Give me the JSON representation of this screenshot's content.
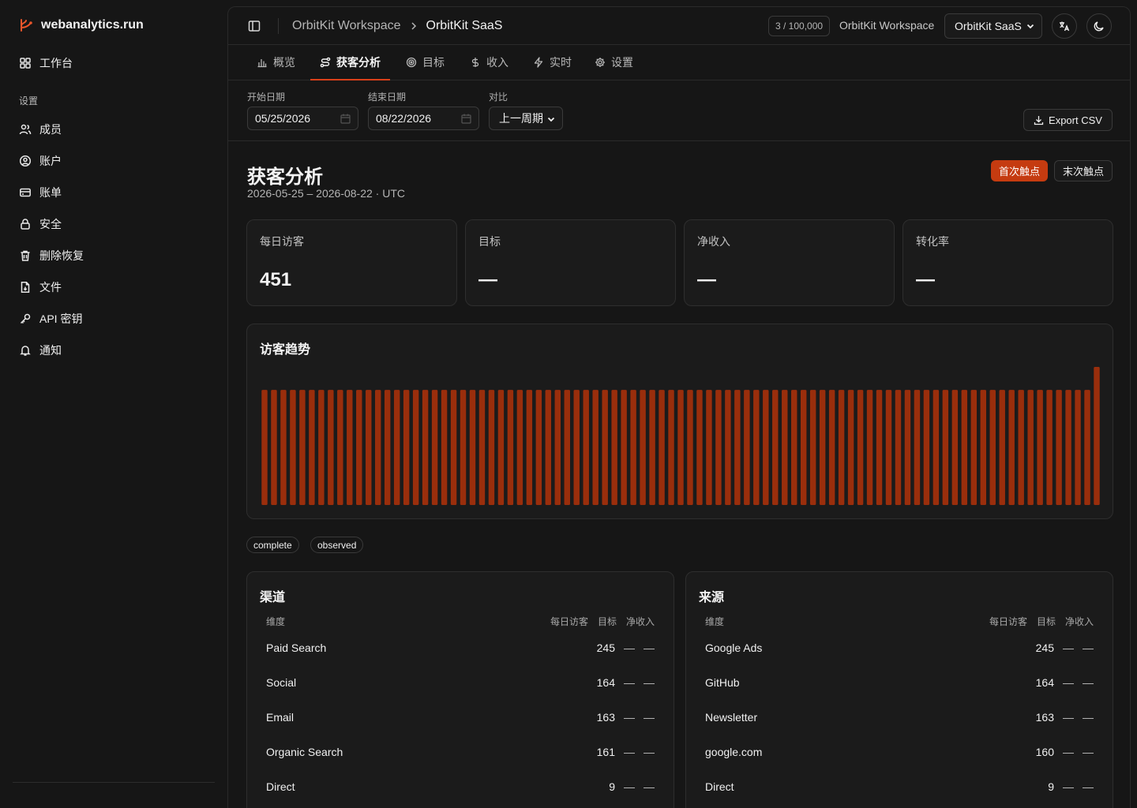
{
  "brand": {
    "name": "webanalytics.run"
  },
  "sidebar": {
    "workbench": "工作台",
    "section_label": "设置",
    "items": [
      {
        "label": "成员",
        "icon": "users-icon"
      },
      {
        "label": "账户",
        "icon": "user-circle-icon"
      },
      {
        "label": "账单",
        "icon": "credit-card-icon"
      },
      {
        "label": "安全",
        "icon": "lock-icon"
      },
      {
        "label": "删除恢复",
        "icon": "trash-icon"
      },
      {
        "label": "文件",
        "icon": "file-icon"
      },
      {
        "label": "API 密钥",
        "icon": "key-icon"
      },
      {
        "label": "通知",
        "icon": "bell-icon"
      }
    ]
  },
  "header": {
    "breadcrumb": [
      "OrbitKit Workspace",
      "OrbitKit SaaS"
    ],
    "usage": "3 / 100,000",
    "workspace": "OrbitKit Workspace",
    "project_select": "OrbitKit SaaS"
  },
  "tabs": [
    {
      "label": "概览",
      "icon": "bar-chart-icon",
      "active": false
    },
    {
      "label": "获客分析",
      "icon": "route-icon",
      "active": true
    },
    {
      "label": "目标",
      "icon": "target-icon",
      "active": false
    },
    {
      "label": "收入",
      "icon": "dollar-icon",
      "active": false
    },
    {
      "label": "实时",
      "icon": "bolt-icon",
      "active": false
    },
    {
      "label": "设置",
      "icon": "gear-icon",
      "active": false
    }
  ],
  "filters": {
    "start_label": "开始日期",
    "start_value": "05/25/2026",
    "end_label": "结束日期",
    "end_value": "08/22/2026",
    "compare_label": "对比",
    "compare_value": "上一周期",
    "export_label": "Export CSV"
  },
  "page": {
    "title": "获客分析",
    "subtitle": "2026-05-25 – 2026-08-22 · UTC",
    "first_touch": "首次触点",
    "last_touch": "末次触点"
  },
  "kpis": [
    {
      "label": "每日访客",
      "value": "451"
    },
    {
      "label": "目标",
      "value": "—"
    },
    {
      "label": "净收入",
      "value": "—"
    },
    {
      "label": "转化率",
      "value": "—"
    }
  ],
  "trend": {
    "title": "访客趋势"
  },
  "pills": [
    "complete",
    "observed"
  ],
  "channels": {
    "title": "渠道",
    "col_dim": "维度",
    "col_visitors": "每日访客",
    "col_goals": "目标",
    "col_revenue": "净收入",
    "rows": [
      {
        "name": "Paid Search",
        "visitors": "245",
        "goals": "—",
        "revenue": "—"
      },
      {
        "name": "Social",
        "visitors": "164",
        "goals": "—",
        "revenue": "—"
      },
      {
        "name": "Email",
        "visitors": "163",
        "goals": "—",
        "revenue": "—"
      },
      {
        "name": "Organic Search",
        "visitors": "161",
        "goals": "—",
        "revenue": "—"
      },
      {
        "name": "Direct",
        "visitors": "9",
        "goals": "—",
        "revenue": "—"
      }
    ]
  },
  "sources": {
    "title": "来源",
    "col_dim": "维度",
    "col_visitors": "每日访客",
    "col_goals": "目标",
    "col_revenue": "净收入",
    "rows": [
      {
        "name": "Google Ads",
        "visitors": "245",
        "goals": "—",
        "revenue": "—"
      },
      {
        "name": "GitHub",
        "visitors": "164",
        "goals": "—",
        "revenue": "—"
      },
      {
        "name": "Newsletter",
        "visitors": "163",
        "goals": "—",
        "revenue": "—"
      },
      {
        "name": "google.com",
        "visitors": "160",
        "goals": "—",
        "revenue": "—"
      },
      {
        "name": "Direct",
        "visitors": "9",
        "goals": "—",
        "revenue": "—"
      }
    ]
  },
  "colors": {
    "accent": "#c53b10",
    "bar": "#9a2e0c",
    "background": "#161616",
    "card": "#1b1b1b"
  },
  "chart_data": {
    "type": "bar",
    "title": "访客趋势",
    "bar_count": 89,
    "values": [
      5,
      5,
      5,
      5,
      5,
      5,
      5,
      5,
      5,
      5,
      5,
      5,
      5,
      5,
      5,
      5,
      5,
      5,
      5,
      5,
      5,
      5,
      5,
      5,
      5,
      5,
      5,
      5,
      5,
      5,
      5,
      5,
      5,
      5,
      5,
      5,
      5,
      5,
      5,
      5,
      5,
      5,
      5,
      5,
      5,
      5,
      5,
      5,
      5,
      5,
      5,
      5,
      5,
      5,
      5,
      5,
      5,
      5,
      5,
      5,
      5,
      5,
      5,
      5,
      5,
      5,
      5,
      5,
      5,
      5,
      5,
      5,
      5,
      5,
      5,
      5,
      5,
      5,
      5,
      5,
      5,
      5,
      5,
      5,
      5,
      5,
      5,
      5,
      6
    ],
    "grid": false,
    "legend": "none"
  }
}
